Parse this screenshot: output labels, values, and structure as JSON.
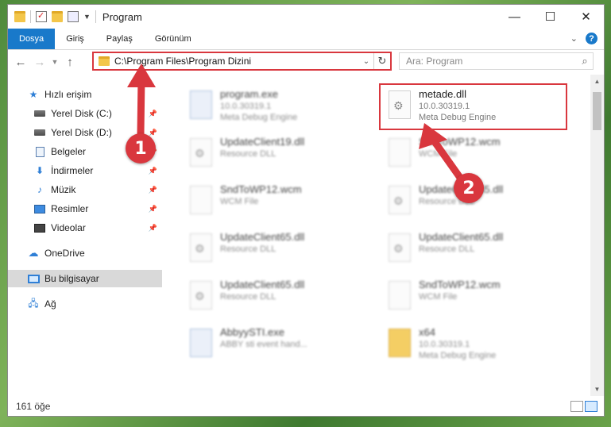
{
  "window": {
    "title": "Program",
    "controls": {
      "minimize": "—",
      "maximize": "☐",
      "close": "✕"
    }
  },
  "ribbon": {
    "tabs": [
      "Dosya",
      "Giriş",
      "Paylaş",
      "Görünüm"
    ],
    "help": "?"
  },
  "nav": {
    "back": "←",
    "forward": "→",
    "up": "↑",
    "address": "C:\\Program Files\\Program Dizini",
    "search_placeholder": "Ara: Program"
  },
  "sidebar": {
    "items": [
      {
        "label": "Hızlı erişim",
        "icon": "star-icon"
      },
      {
        "label": "Yerel Disk (C:)",
        "icon": "drive-icon",
        "pinned": true
      },
      {
        "label": "Yerel Disk (D:)",
        "icon": "drive-icon",
        "pinned": true
      },
      {
        "label": "Belgeler",
        "icon": "document-icon",
        "pinned": true
      },
      {
        "label": "İndirmeler",
        "icon": "download-icon",
        "pinned": true
      },
      {
        "label": "Müzik",
        "icon": "music-icon",
        "pinned": true
      },
      {
        "label": "Resimler",
        "icon": "picture-icon",
        "pinned": true
      },
      {
        "label": "Videolar",
        "icon": "video-icon",
        "pinned": true
      },
      {
        "label": "OneDrive",
        "icon": "cloud-icon"
      },
      {
        "label": "Bu bilgisayar",
        "icon": "computer-icon",
        "selected": true
      },
      {
        "label": "Ağ",
        "icon": "network-icon"
      }
    ]
  },
  "files": [
    {
      "name": "program.exe",
      "line1": "10.0.30319.1",
      "line2": "Meta Debug Engine",
      "icon": "exe-icon"
    },
    {
      "name": "metade.dll",
      "line1": "10.0.30319.1",
      "line2": "Meta Debug Engine",
      "icon": "dll-gear-icon",
      "highlighted": true
    },
    {
      "name": "UpdateClient19.dll",
      "line1": "Resource DLL",
      "line2": "",
      "icon": "dll-gear-icon"
    },
    {
      "name": "SndToWP12.wcm",
      "line1": "WCM File",
      "line2": "",
      "icon": "blank-file-icon"
    },
    {
      "name": "SndToWP12.wcm",
      "line1": "WCM File",
      "line2": "",
      "icon": "blank-file-icon"
    },
    {
      "name": "UpdateClient65.dll",
      "line1": "Resource DLL",
      "line2": "",
      "icon": "dll-gear-icon"
    },
    {
      "name": "UpdateClient65.dll",
      "line1": "Resource DLL",
      "line2": "",
      "icon": "dll-gear-icon"
    },
    {
      "name": "UpdateClient65.dll",
      "line1": "Resource DLL",
      "line2": "",
      "icon": "dll-gear-icon"
    },
    {
      "name": "UpdateClient65.dll",
      "line1": "Resource DLL",
      "line2": "",
      "icon": "dll-gear-icon"
    },
    {
      "name": "SndToWP12.wcm",
      "line1": "WCM File",
      "line2": "",
      "icon": "blank-file-icon"
    },
    {
      "name": "AbbyySTI.exe",
      "line1": "ABBY sti event hand...",
      "line2": "",
      "icon": "exe-icon"
    },
    {
      "name": "x64",
      "line1": "10.0.30319.1",
      "line2": "Meta Debug Engine",
      "icon": "folder-icon"
    }
  ],
  "status": {
    "count": "161 öğe"
  },
  "annotations": {
    "marker1": "1",
    "marker2": "2",
    "color": "#d9373e"
  },
  "colors": {
    "accent": "#1979ca",
    "highlight": "#d9373e"
  }
}
